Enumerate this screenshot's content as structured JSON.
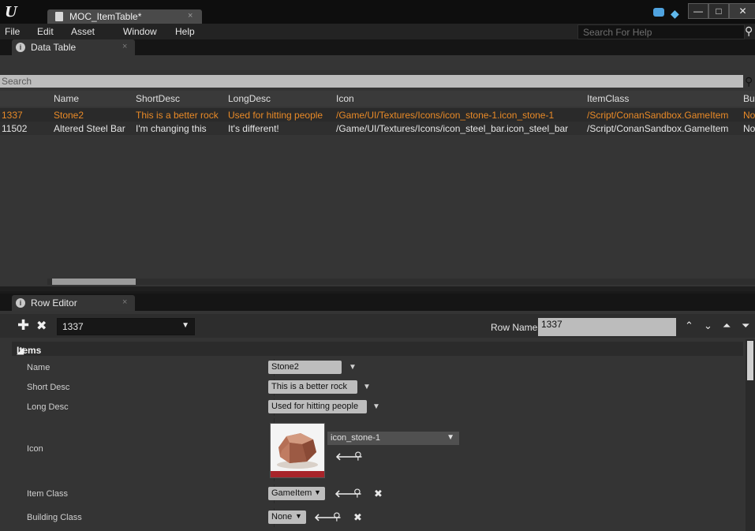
{
  "window": {
    "doc_tab_title": "MOC_ItemTable*",
    "tab_close": "×",
    "min": "—",
    "max": "□",
    "close": "✕"
  },
  "menu": {
    "items": [
      "File",
      "Edit",
      "Asset",
      "Window",
      "Help"
    ],
    "help_search_placeholder": "Search For Help"
  },
  "data_table": {
    "tab_label": "Data Table",
    "search_placeholder": "Search",
    "columns": [
      "Name",
      "ShortDesc",
      "LongDesc",
      "Icon",
      "ItemClass",
      "Bu"
    ],
    "rows": [
      {
        "id": "1337",
        "name": "Stone2",
        "short": "This is a better rock",
        "long": "Used for hitting people",
        "icon": "/Game/UI/Textures/Icons/icon_stone-1.icon_stone-1",
        "item_class": "/Script/ConanSandbox.GameItem",
        "bu": "No"
      },
      {
        "id": "11502",
        "name": "Altered Steel Bar",
        "short": "I'm changing this",
        "long": "It's different!",
        "icon": "/Game/UI/Textures/Icons/icon_steel_bar.icon_steel_bar",
        "item_class": "/Script/ConanSandbox.GameItem",
        "bu": "No"
      }
    ]
  },
  "row_editor": {
    "tab_label": "Row Editor",
    "selected_row": "1337",
    "row_name_label": "Row Name:",
    "row_name_value": "1337",
    "section_title": "Items",
    "props": {
      "name_label": "Name",
      "name_value": "Stone2",
      "short_label": "Short Desc",
      "short_value": "This is a better rock",
      "long_label": "Long Desc",
      "long_value": "Used for hitting people",
      "icon_label": "Icon",
      "icon_value": "icon_stone-1",
      "item_class_label": "Item Class",
      "item_class_value": "GameItem",
      "building_class_label": "Building Class",
      "building_class_value": "None"
    }
  }
}
